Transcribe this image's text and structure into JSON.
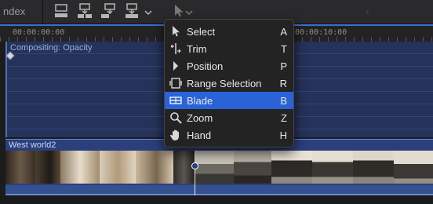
{
  "toolbar": {
    "index_label": "ndex",
    "buttons": [
      "connect-clip-icon",
      "insert-clip-icon",
      "append-clip-icon",
      "overwrite-clip-icon",
      "edit-options-chevron-icon"
    ],
    "tool_selector": "arrow-icon"
  },
  "ruler": {
    "tc_start": "00:00:00:00",
    "tc_mid": "00:00:10:00"
  },
  "compositing": {
    "title": "Compositing: Opacity"
  },
  "clip": {
    "name": "West world2"
  },
  "tools_menu": {
    "items": [
      {
        "label": "Select",
        "shortcut": "A",
        "icon": "arrow-icon"
      },
      {
        "label": "Trim",
        "shortcut": "T",
        "icon": "trim-icon"
      },
      {
        "label": "Position",
        "shortcut": "P",
        "icon": "position-icon"
      },
      {
        "label": "Range Selection",
        "shortcut": "R",
        "icon": "range-selection-icon"
      },
      {
        "label": "Blade",
        "shortcut": "B",
        "icon": "blade-icon"
      },
      {
        "label": "Zoom",
        "shortcut": "Z",
        "icon": "zoom-icon"
      },
      {
        "label": "Hand",
        "shortcut": "H",
        "icon": "hand-icon"
      }
    ],
    "selected": "Blade"
  },
  "colors": {
    "accent": "#2a63d6",
    "clip": "#2a3f7c",
    "comp_lane": "#25325a"
  }
}
